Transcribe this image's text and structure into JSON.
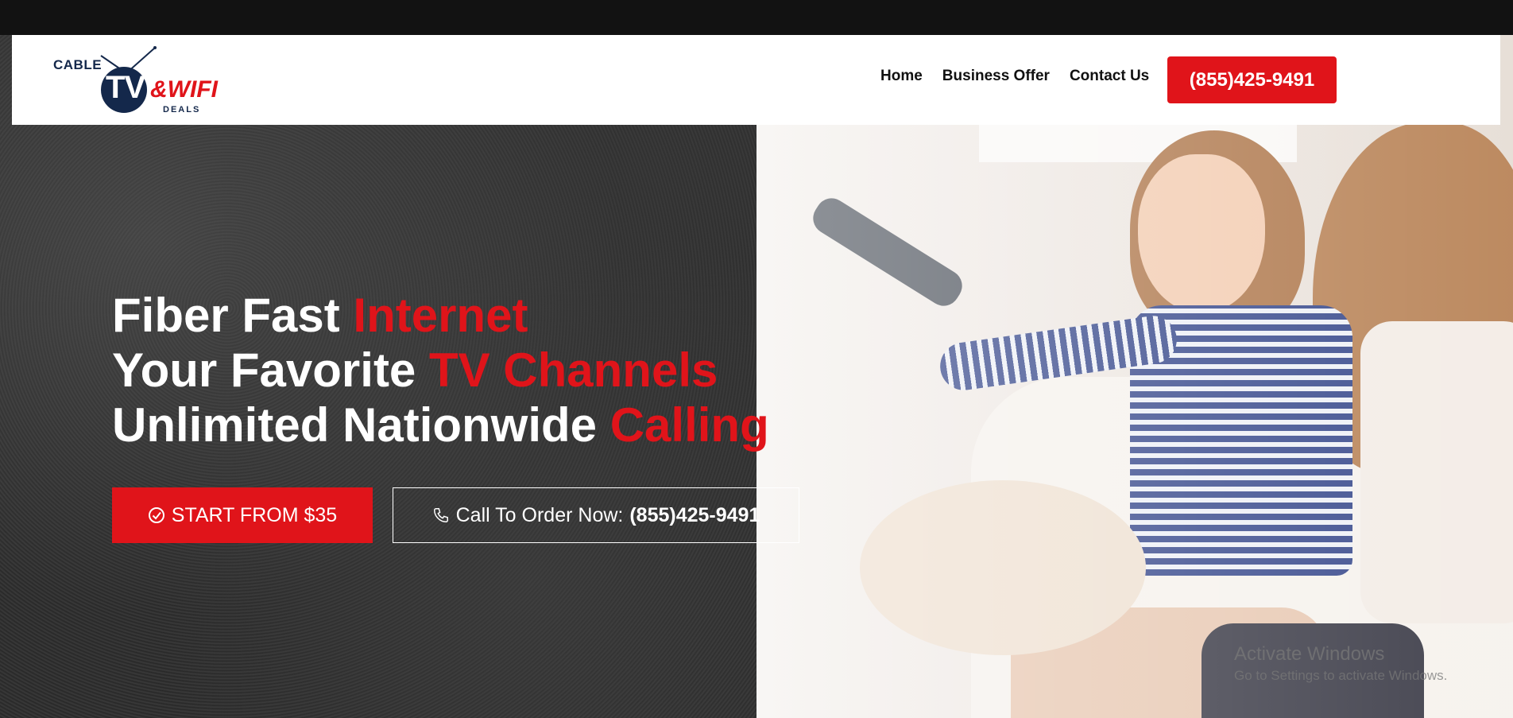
{
  "header": {
    "logo": {
      "cable": "CABLE",
      "tv": "TV",
      "wifi": "&WIFI",
      "deals": "DEALS"
    },
    "nav": {
      "home": "Home",
      "business_offer": "Business Offer",
      "contact_us": "Contact Us"
    },
    "phone_button": "(855)425-9491"
  },
  "hero": {
    "line1_white": "Fiber Fast ",
    "line1_red": "Internet",
    "line2_white": "Your Favorite ",
    "line2_red": "TV Channels",
    "line3_white": "Unlimited Nationwide ",
    "line3_red": "Calling",
    "start_button": "START FROM $35",
    "call_label": "Call To Order Now: ",
    "call_number": "(855)425-9491"
  },
  "watermark": {
    "title": "Activate Windows",
    "subtitle": "Go to Settings to activate Windows."
  },
  "icons": {
    "start": "check-circle-icon",
    "call": "phone-icon",
    "logo_antenna": "antenna-icon"
  },
  "colors": {
    "accent_red": "#e0141a",
    "logo_navy": "#14284b",
    "dark_bg": "#2c2c2c"
  }
}
